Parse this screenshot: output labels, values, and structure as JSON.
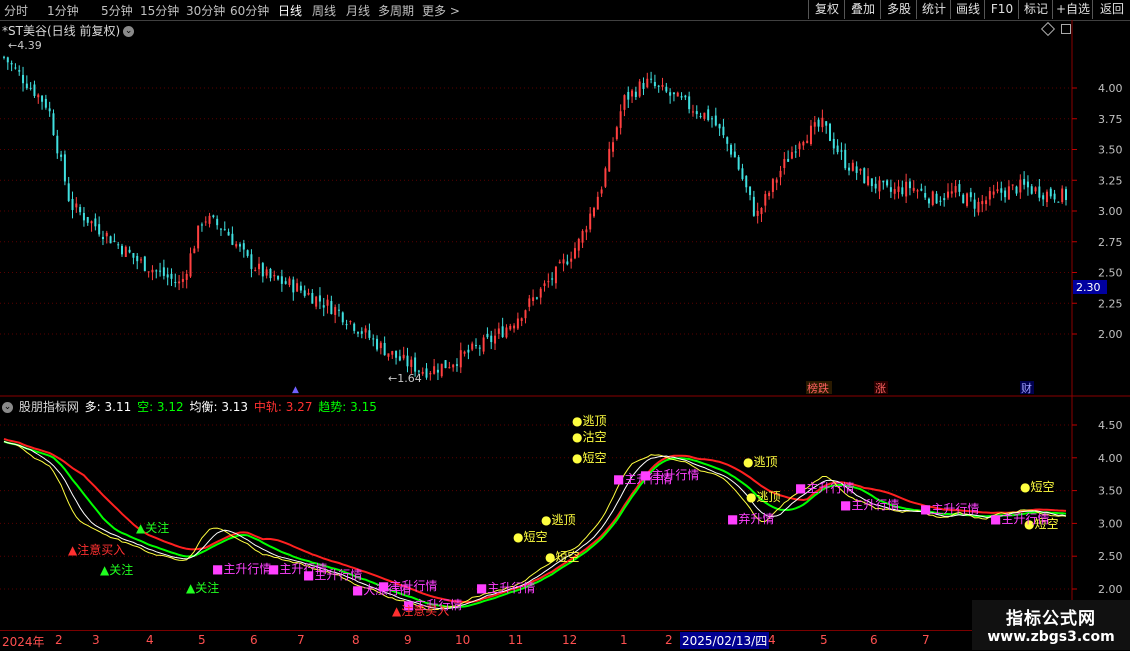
{
  "toolbar": {
    "timeframes": [
      "分时",
      "1分钟",
      "5分钟",
      "15分钟",
      "30分钟",
      "60分钟",
      "日线",
      "周线",
      "月线",
      "多周期",
      "更多"
    ],
    "active_timeframe": "日线",
    "right_buttons": [
      "复权",
      "叠加",
      "多股",
      "统计",
      "画线",
      "F10",
      "标记",
      "+自选",
      "返回"
    ]
  },
  "chart_title": "*ST美谷(日线 前复权)",
  "price_axis": {
    "labels": [
      "4.00",
      "3.75",
      "3.50",
      "3.25",
      "3.00",
      "2.75",
      "2.50",
      "2.25",
      "2.00"
    ],
    "current_price": "2.30"
  },
  "price_annotations": {
    "high": "4.39",
    "low": "1.64"
  },
  "event_markers": [
    "榜跌",
    "涨",
    "财"
  ],
  "indicator": {
    "name": "股朋指标网",
    "values": [
      {
        "label": "多:",
        "value": "3.11",
        "color": "#ffffff"
      },
      {
        "label": "空:",
        "value": "3.12",
        "color": "#00ff00"
      },
      {
        "label": "均衡:",
        "value": "3.13",
        "color": "#ffffff"
      },
      {
        "label": "中轨:",
        "value": "3.27",
        "color": "#ff3030"
      },
      {
        "label": "趋势:",
        "value": "3.15",
        "color": "#00ff00"
      }
    ],
    "axis_labels": [
      "4.50",
      "4.00",
      "3.50",
      "3.00",
      "2.50",
      "2.00"
    ],
    "signals": {
      "yellow": [
        "逃顶",
        "沽空",
        "逃顶",
        "短空",
        "短空",
        "逃顶",
        "短空",
        "逃顶",
        "短空",
        "短空"
      ],
      "magenta": [
        "主升行情",
        "主升行情",
        "主升行情",
        "主升行情",
        "大涨行情",
        "主升行情",
        "主升行情",
        "主升行情",
        "弃升情",
        "主升行情",
        "主升行情",
        "主升行情",
        "主升行情",
        "主升行情"
      ],
      "red": [
        "注意买入",
        "注意买入"
      ],
      "green": [
        "关注",
        "关注",
        "关注"
      ]
    }
  },
  "x_axis": {
    "labels": [
      "2024年",
      "2",
      "3",
      "4",
      "5",
      "6",
      "7",
      "8",
      "9",
      "10",
      "11",
      "12",
      "1",
      "2",
      "2025/02/13/四",
      "4",
      "5",
      "6",
      "7"
    ]
  },
  "watermark": {
    "line1": "指标公式网",
    "line2": "www.zbgs3.com"
  },
  "chart_data": {
    "type": "candlestick",
    "title": "*ST美谷(日线 前复权)",
    "x_period": [
      "2024-01",
      "2025-07"
    ],
    "ylim": [
      1.55,
      4.55
    ],
    "high": 4.39,
    "low": 1.64,
    "current": 2.3,
    "close_path": [
      4.25,
      4.05,
      3.85,
      3.05,
      2.9,
      2.75,
      2.6,
      2.5,
      2.4,
      2.95,
      2.85,
      2.6,
      2.45,
      2.4,
      2.3,
      2.2,
      2.05,
      1.9,
      1.78,
      1.7,
      1.75,
      1.85,
      1.95,
      2.1,
      2.3,
      2.5,
      2.75,
      3.2,
      3.9,
      4.05,
      3.95,
      3.85,
      3.75,
      3.45,
      2.95,
      3.3,
      3.6,
      3.7,
      3.4,
      3.25,
      3.15,
      3.2,
      3.1,
      3.15,
      3.05,
      3.15,
      3.2,
      3.15,
      3.12
    ]
  }
}
